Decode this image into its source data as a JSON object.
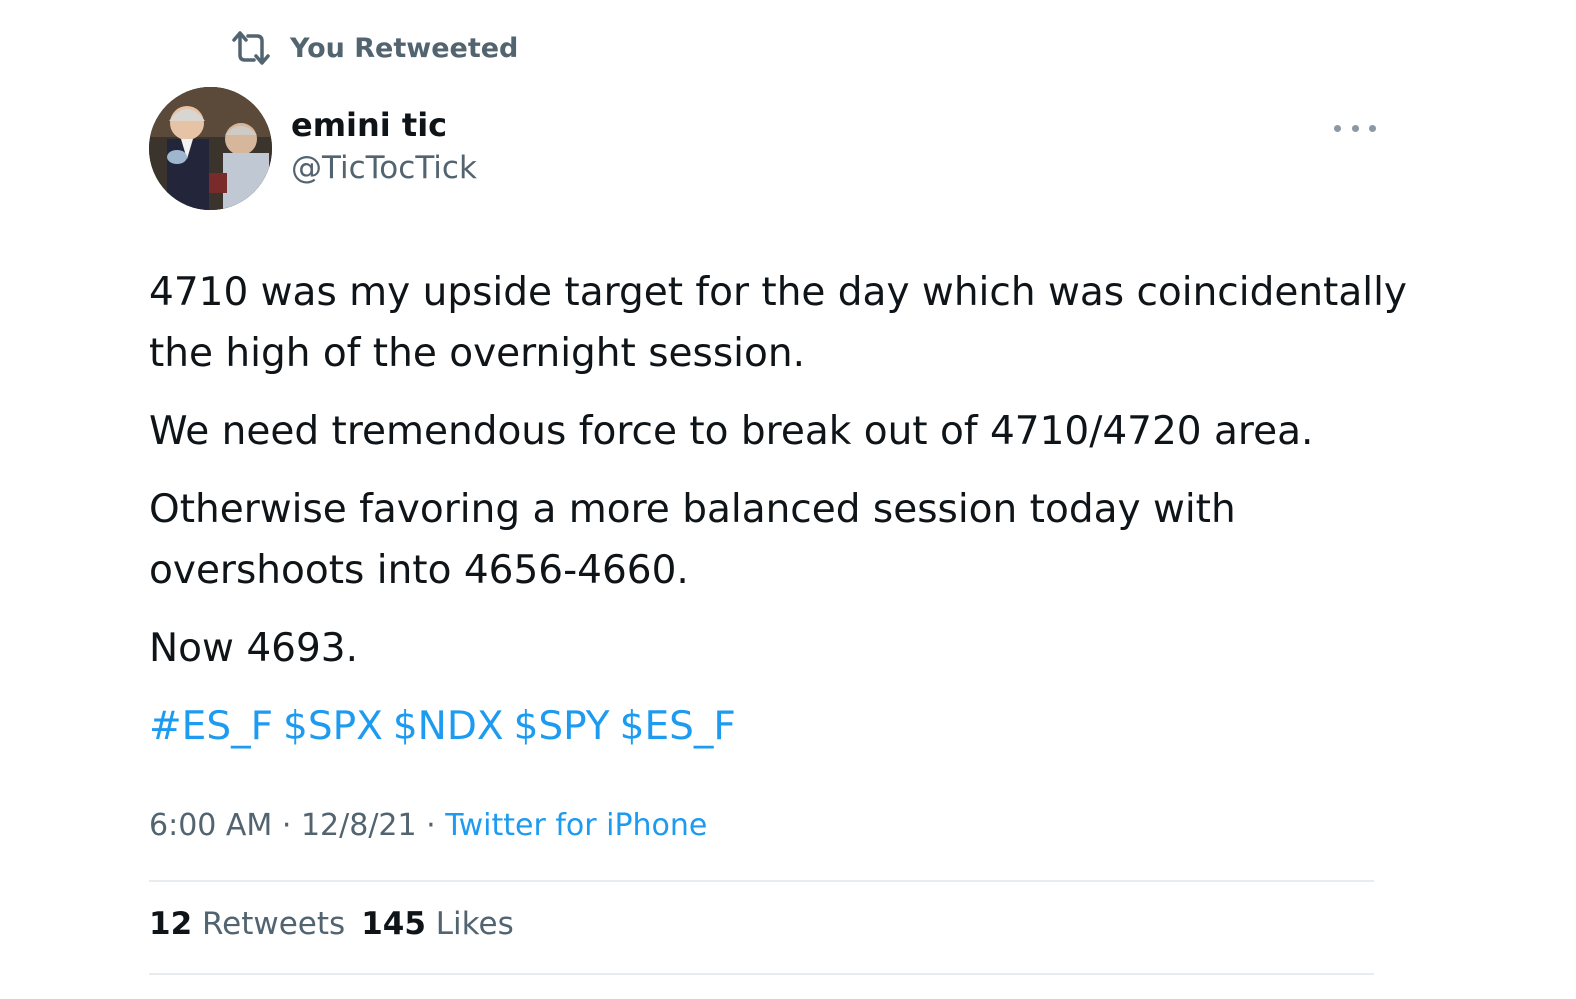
{
  "retweet_banner": {
    "text": "You Retweeted",
    "icon": "retweet-icon"
  },
  "author": {
    "display_name": "emini tic",
    "handle": "@TicTocTick",
    "avatar": "avatar-photo"
  },
  "more_icon": "more-options-icon",
  "tweet": {
    "paragraphs": [
      "4710 was my upside target for the day which was coincidentally the high of the overnight session.",
      "We need tremendous force to break out of 4710/4720 area.",
      "Otherwise favoring a more balanced session today with overshoots into 4656-4660.",
      "Now 4693."
    ],
    "hashtags": [
      "#ES_F",
      "$SPX",
      "$NDX",
      "$SPY",
      "$ES_F"
    ]
  },
  "meta": {
    "time": "6:00 AM",
    "separator": "·",
    "date": "12/8/21",
    "source": "Twitter for iPhone"
  },
  "stats": {
    "retweets_count": "12",
    "retweets_label": "Retweets",
    "likes_count": "145",
    "likes_label": "Likes"
  },
  "colors": {
    "link": "#1d9bf0",
    "secondary_text": "#536471",
    "primary_text": "#0f1419",
    "divider": "#e6ecf0"
  }
}
